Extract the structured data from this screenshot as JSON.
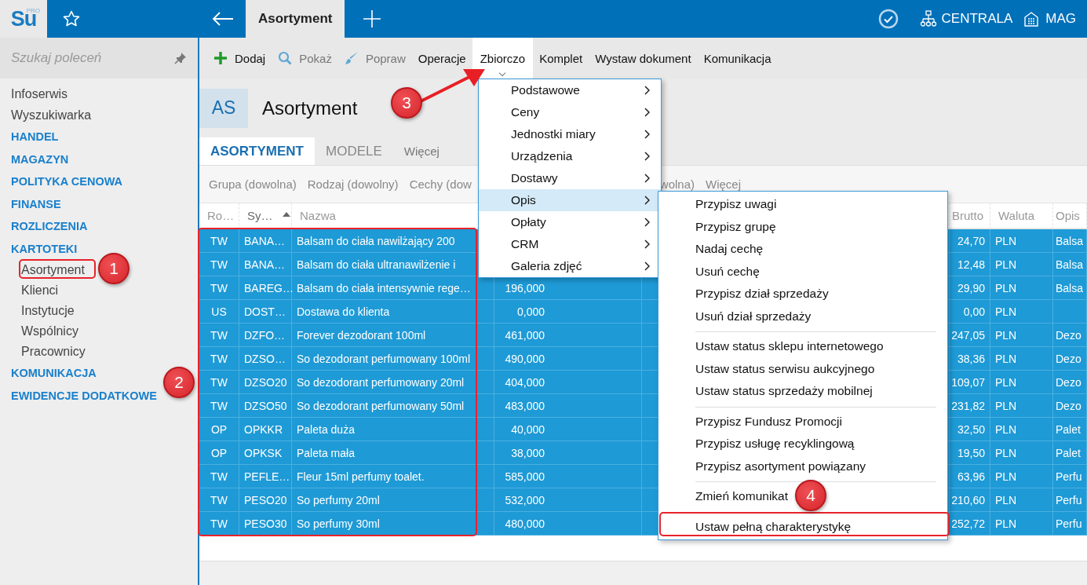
{
  "logo": {
    "text": "Su",
    "badge": "PRO"
  },
  "top_bar": {
    "tabs": [
      {
        "label": "Asortyment",
        "selected": true
      }
    ],
    "branch": "CENTRALA",
    "store": "MAG"
  },
  "sidebar": {
    "search": {
      "placeholder": "Szukaj poleceń"
    },
    "items": [
      {
        "label": "Infoserwis",
        "kind": "link"
      },
      {
        "label": "Wyszukiwarka",
        "kind": "link"
      },
      {
        "label": "HANDEL",
        "kind": "section"
      },
      {
        "label": "MAGAZYN",
        "kind": "section"
      },
      {
        "label": "POLITYKA CENOWA",
        "kind": "section"
      },
      {
        "label": "FINANSE",
        "kind": "section"
      },
      {
        "label": "ROZLICZENIA",
        "kind": "section"
      },
      {
        "label": "KARTOTEKI",
        "kind": "section",
        "children": [
          {
            "label": "Asortyment"
          },
          {
            "label": "Klienci"
          },
          {
            "label": "Instytucje"
          },
          {
            "label": "Wspólnicy"
          },
          {
            "label": "Pracownicy"
          }
        ]
      },
      {
        "label": "KOMUNIKACJA",
        "kind": "section"
      },
      {
        "label": "EWIDENCJE DODATKOWE",
        "kind": "section"
      }
    ]
  },
  "toolbar": [
    {
      "label": "Dodaj",
      "kind": "add",
      "disabled": false,
      "selected": false
    },
    {
      "label": "Pokaż",
      "kind": "show",
      "disabled": true,
      "selected": false
    },
    {
      "label": "Popraw",
      "kind": "edit",
      "disabled": true,
      "selected": false
    },
    {
      "label": "Operacje",
      "kind": "plain",
      "disabled": false,
      "selected": false
    },
    {
      "label": "Zbiorczo",
      "kind": "plain",
      "disabled": false,
      "selected": true
    },
    {
      "label": "Komplet",
      "kind": "plain",
      "disabled": false,
      "selected": false
    },
    {
      "label": "Wystaw dokument",
      "kind": "plain",
      "disabled": false,
      "selected": false
    },
    {
      "label": "Komunikacja",
      "kind": "plain",
      "disabled": false,
      "selected": false
    }
  ],
  "header": {
    "badge": "AS",
    "title": "Asortyment"
  },
  "tabs": [
    {
      "label": "ASORTYMENT",
      "selected": true
    },
    {
      "label": "MODELE",
      "selected": false
    },
    {
      "label": "Więcej",
      "selected": false
    }
  ],
  "filters": [
    "Grupa (dowolna)",
    "Rodzaj (dowolny)",
    "Cechy (dow",
    "wolna)",
    "Więcej"
  ],
  "table": {
    "columns": [
      {
        "label": "Ro…",
        "sorted": false
      },
      {
        "label": "Sy…",
        "sorted": true
      },
      {
        "label": "Nazwa",
        "sorted": false
      },
      {
        "label": "Brutto",
        "sorted": false
      },
      {
        "label": "Waluta",
        "sorted": false
      },
      {
        "label": "Opis",
        "sorted": false
      }
    ],
    "rows": [
      {
        "typ": "TW",
        "symbol": "BANA…",
        "nazwa": "Balsam do ciała nawilżający 200",
        "brutto": "24,70",
        "waluta": "PLN",
        "opis": "Balsa",
        "selected": true
      },
      {
        "typ": "TW",
        "symbol": "BANA…",
        "nazwa": "Balsam do ciała ultranawilżenie i",
        "brutto": "12,48",
        "waluta": "PLN",
        "opis": "Balsa",
        "selected": true
      },
      {
        "typ": "TW",
        "symbol": "BAREG…",
        "nazwa": "Balsam do ciała intensywnie rege…",
        "column_4": "196,000",
        "brutto": "29,90",
        "waluta": "PLN",
        "opis": "Balsa",
        "selected": true
      },
      {
        "typ": "US",
        "symbol": "DOST…",
        "nazwa": "Dostawa do klienta",
        "column_4": "0,000",
        "brutto": "0,00",
        "waluta": "PLN",
        "selected": true
      },
      {
        "typ": "TW",
        "symbol": "DZFO…",
        "nazwa": "Forever dezodorant 100ml",
        "column_4": "461,000",
        "brutto": "247,05",
        "waluta": "PLN",
        "opis": "Dezo",
        "selected": true
      },
      {
        "typ": "TW",
        "symbol": "DZSO…",
        "nazwa": "So dezodorant perfumowany 100ml",
        "column_4": "490,000",
        "brutto": "38,36",
        "waluta": "PLN",
        "opis": "Dezo",
        "selected": true
      },
      {
        "typ": "TW",
        "symbol": "DZSO20",
        "nazwa": "So dezodorant perfumowany 20ml",
        "column_4": "404,000",
        "brutto": "109,07",
        "waluta": "PLN",
        "opis": "Dezo",
        "selected": true
      },
      {
        "typ": "TW",
        "symbol": "DZSO50",
        "nazwa": "So dezodorant perfumowany 50ml",
        "column_4": "483,000",
        "brutto": "231,82",
        "waluta": "PLN",
        "opis": "Dezo",
        "selected": true
      },
      {
        "typ": "OP",
        "symbol": "OPKKR",
        "nazwa": "Paleta duża",
        "column_4": "40,000",
        "brutto": "32,50",
        "waluta": "PLN",
        "opis": "Palet",
        "selected": true
      },
      {
        "typ": "OP",
        "symbol": "OPKSK",
        "nazwa": "Paleta mała",
        "column_4": "38,000",
        "brutto": "19,50",
        "waluta": "PLN",
        "opis": "Palet",
        "selected": true
      },
      {
        "typ": "TW",
        "symbol": "PEFLE…",
        "nazwa": "Fleur 15ml perfumy toalet.",
        "column_4": "585,000",
        "brutto": "63,96",
        "waluta": "PLN",
        "opis": "Perfu",
        "selected": true
      },
      {
        "typ": "TW",
        "symbol": "PESO20",
        "nazwa": "So perfumy 20ml",
        "column_4": "532,000",
        "brutto": "210,60",
        "waluta": "PLN",
        "opis": "Perfu",
        "selected": true
      },
      {
        "typ": "TW",
        "symbol": "PESO30",
        "nazwa": "So perfumy 30ml",
        "column_4": "480,000",
        "brutto": "252,72",
        "waluta": "PLN",
        "opis": "Perfu",
        "selected": true
      }
    ]
  },
  "menu": {
    "items": [
      {
        "label": "Podstawowe",
        "selected": false
      },
      {
        "label": "Ceny",
        "selected": false
      },
      {
        "label": "Jednostki miary",
        "selected": false
      },
      {
        "label": "Urządzenia",
        "selected": false
      },
      {
        "label": "Dostawy",
        "selected": false
      },
      {
        "label": "Opis",
        "selected": true
      },
      {
        "label": "Opłaty",
        "selected": false
      },
      {
        "label": "CRM",
        "selected": false
      },
      {
        "label": "Galeria zdjęć",
        "selected": false
      }
    ]
  },
  "submenu": {
    "groups": [
      [
        "Przypisz uwagi",
        "Przypisz grupę",
        "Nadaj cechę",
        "Usuń cechę",
        "Przypisz dział sprzedaży",
        "Usuń dział sprzedaży"
      ],
      [
        "Ustaw status sklepu internetowego",
        "Ustaw status serwisu aukcyjnego",
        "Ustaw status sprzedaży mobilnej"
      ],
      [
        "Przypisz Fundusz Promocji",
        "Przypisz usługę recyklingową",
        "Przypisz asortyment powiązany"
      ],
      [
        "Zmień komunikat"
      ],
      [
        "Ustaw pełną charakterystykę"
      ]
    ]
  },
  "annotations": [
    {
      "label": "1"
    },
    {
      "label": "2"
    },
    {
      "label": "3"
    },
    {
      "label": "4"
    }
  ]
}
